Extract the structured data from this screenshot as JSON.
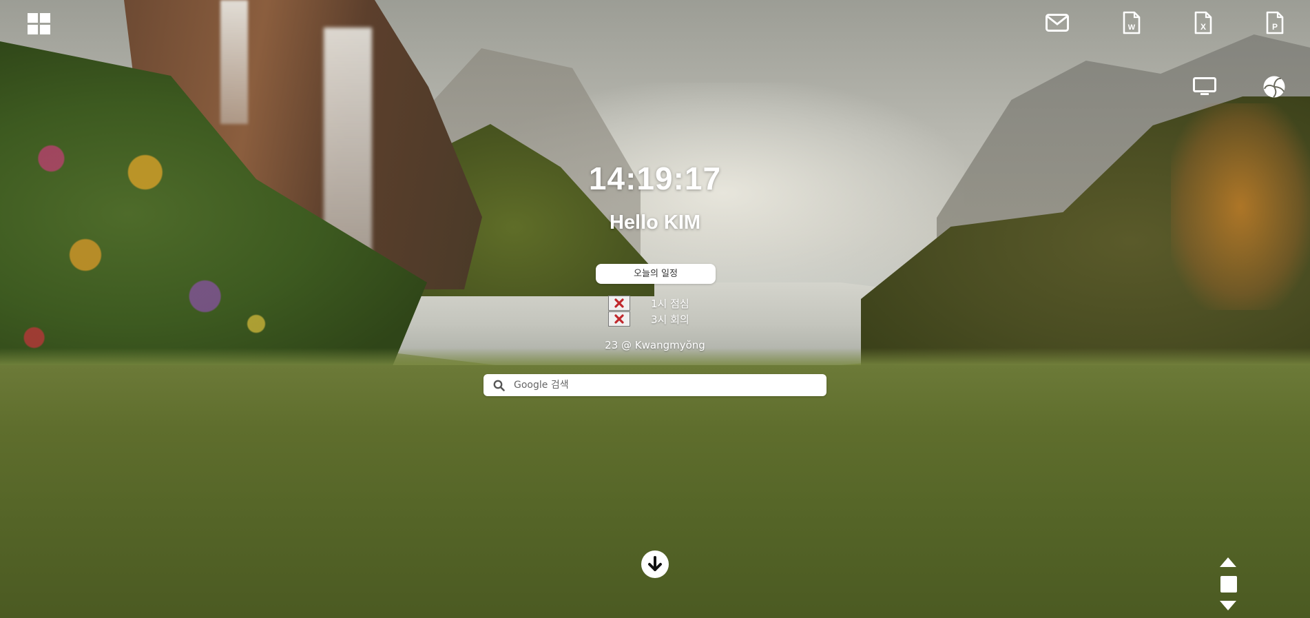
{
  "clock": {
    "time": "14:19:17"
  },
  "greeting": {
    "text": "Hello KIM"
  },
  "schedule": {
    "button_label": "오늘의 일정",
    "items": [
      {
        "text": "1시 점심"
      },
      {
        "text": "3시 회의"
      }
    ]
  },
  "weather": {
    "text": "23 @ Kwangmyŏng"
  },
  "search": {
    "placeholder": "Google 검색",
    "value": ""
  },
  "icons": {
    "top_left": "windows-grid-icon",
    "top_right": [
      "mail-icon",
      "word-file-icon",
      "excel-file-icon",
      "powerpoint-file-icon"
    ],
    "second_row": [
      "monitor-icon",
      "volleyball-icon"
    ],
    "bottom_center": "arrow-down-circle-icon",
    "bottom_right": [
      "caret-up-icon",
      "square-icon",
      "caret-down-icon"
    ]
  },
  "colors": {
    "text": "#ffffff",
    "delete_x": "#c0282d",
    "panel": "#ffffff"
  }
}
